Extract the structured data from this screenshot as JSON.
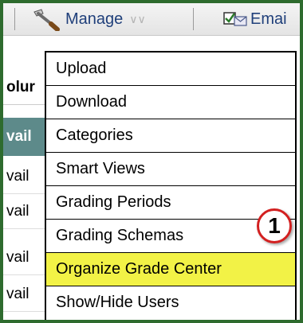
{
  "toolbar": {
    "manage_label": "Manage",
    "email_label": "Emai"
  },
  "background": {
    "column_header": "olur",
    "available_header": "vail",
    "cells": [
      "vail",
      "vail",
      "vail",
      "vail"
    ]
  },
  "manage_menu": {
    "items": [
      "Upload",
      "Download",
      "Categories",
      "Smart Views",
      "Grading Periods",
      "Grading Schemas",
      "Organize Grade Center",
      "Show/Hide Users"
    ],
    "highlighted_index": 6
  },
  "callout": {
    "number": "1"
  },
  "colors": {
    "highlight": "#f2f246",
    "callout_border": "#d32020",
    "frame": "#2e6b2e",
    "available_header_bg": "#5d8a8a"
  }
}
